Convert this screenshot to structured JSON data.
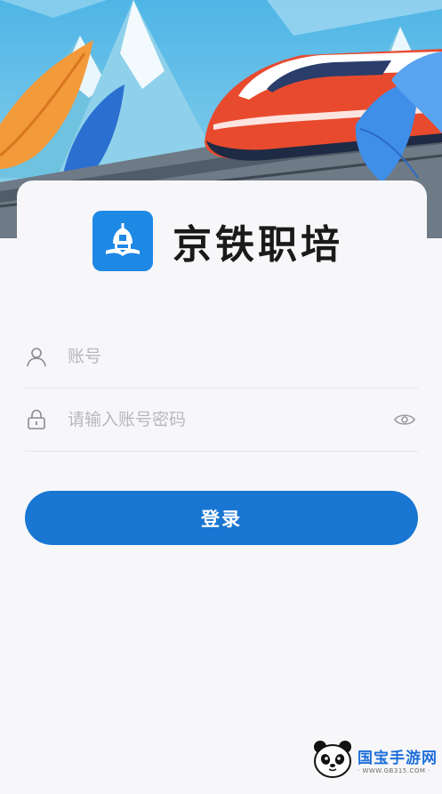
{
  "brand": {
    "name": "京铁职培",
    "logo_icon": "building-book-logo-icon"
  },
  "form": {
    "account_placeholder": "账号",
    "password_placeholder": "请输入账号密码",
    "login_label": "登录"
  },
  "watermark": {
    "title": "国宝手游网",
    "url": "· WWW.GB315.COM ·"
  },
  "colors": {
    "primary": "#1976d2",
    "logo_bg": "#1e88e5",
    "train": "#e84a2e"
  }
}
